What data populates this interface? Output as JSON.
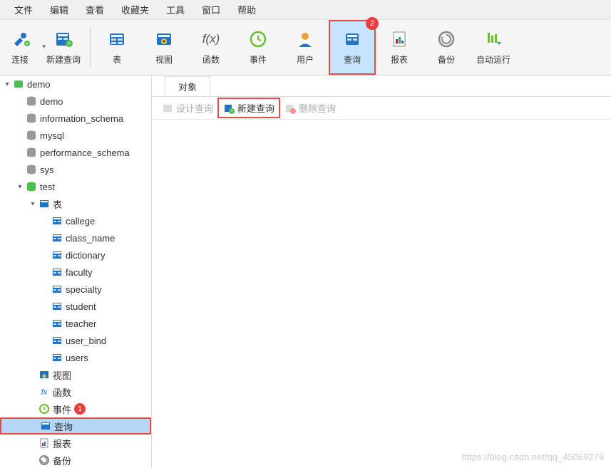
{
  "menu": {
    "items": [
      "文件",
      "编辑",
      "查看",
      "收藏夹",
      "工具",
      "窗口",
      "帮助"
    ]
  },
  "toolbar": {
    "items": [
      {
        "id": "connect",
        "label": "连接",
        "color": "#2374c7",
        "icon": "plug"
      },
      {
        "id": "newquery",
        "label": "新建查询",
        "color": "#2374c7",
        "icon": "query-plus"
      },
      {
        "id": "sep"
      },
      {
        "id": "table",
        "label": "表",
        "color": "#2374c7",
        "icon": "table"
      },
      {
        "id": "view",
        "label": "视图",
        "color": "#2374c7",
        "icon": "view"
      },
      {
        "id": "func",
        "label": "函数",
        "color": "#555",
        "icon": "fx"
      },
      {
        "id": "event",
        "label": "事件",
        "color": "#6abf2e",
        "icon": "clock"
      },
      {
        "id": "user",
        "label": "用户",
        "color": "#f0a030",
        "icon": "user"
      },
      {
        "id": "query",
        "label": "查询",
        "color": "#2374c7",
        "icon": "query",
        "highlight": true,
        "badge": "2"
      },
      {
        "id": "report",
        "label": "报表",
        "color": "#c44",
        "icon": "report"
      },
      {
        "id": "backup",
        "label": "备份",
        "color": "#888",
        "icon": "backup"
      },
      {
        "id": "autorun",
        "label": "自动运行",
        "color": "#6abf2e",
        "icon": "autorun"
      }
    ]
  },
  "tree": {
    "root": {
      "label": "demo",
      "children": [
        {
          "label": "demo",
          "icon": "db-grey"
        },
        {
          "label": "information_schema",
          "icon": "db-grey"
        },
        {
          "label": "mysql",
          "icon": "db-grey"
        },
        {
          "label": "performance_schema",
          "icon": "db-grey"
        },
        {
          "label": "sys",
          "icon": "db-grey"
        },
        {
          "label": "test",
          "icon": "db-green",
          "expanded": true,
          "children": [
            {
              "label": "表",
              "icon": "table-folder",
              "expanded": true,
              "children": [
                {
                  "label": "callege",
                  "icon": "table-blue"
                },
                {
                  "label": "class_name",
                  "icon": "table-blue"
                },
                {
                  "label": "dictionary",
                  "icon": "table-blue"
                },
                {
                  "label": "faculty",
                  "icon": "table-blue"
                },
                {
                  "label": "specialty",
                  "icon": "table-blue"
                },
                {
                  "label": "student",
                  "icon": "table-blue"
                },
                {
                  "label": "teacher",
                  "icon": "table-blue"
                },
                {
                  "label": "user_bind",
                  "icon": "table-blue"
                },
                {
                  "label": "users",
                  "icon": "table-blue"
                }
              ]
            },
            {
              "label": "视图",
              "icon": "view-small"
            },
            {
              "label": "函数",
              "icon": "fx-small"
            },
            {
              "label": "事件",
              "icon": "clock-small",
              "badge": "1"
            },
            {
              "label": "查询",
              "icon": "query-small",
              "selected": true
            },
            {
              "label": "报表",
              "icon": "report-small"
            },
            {
              "label": "备份",
              "icon": "backup-small"
            }
          ]
        }
      ]
    }
  },
  "tabs": {
    "active": "对象",
    "items": [
      "对象"
    ]
  },
  "sub_toolbar": {
    "items": [
      {
        "label": "设计查询",
        "icon": "design",
        "disabled": true
      },
      {
        "label": "新建查询",
        "icon": "newq",
        "highlight": true
      },
      {
        "label": "删除查询",
        "icon": "delq",
        "disabled": true
      }
    ]
  },
  "watermark": "https://blog.csdn.net/qq_45069279"
}
